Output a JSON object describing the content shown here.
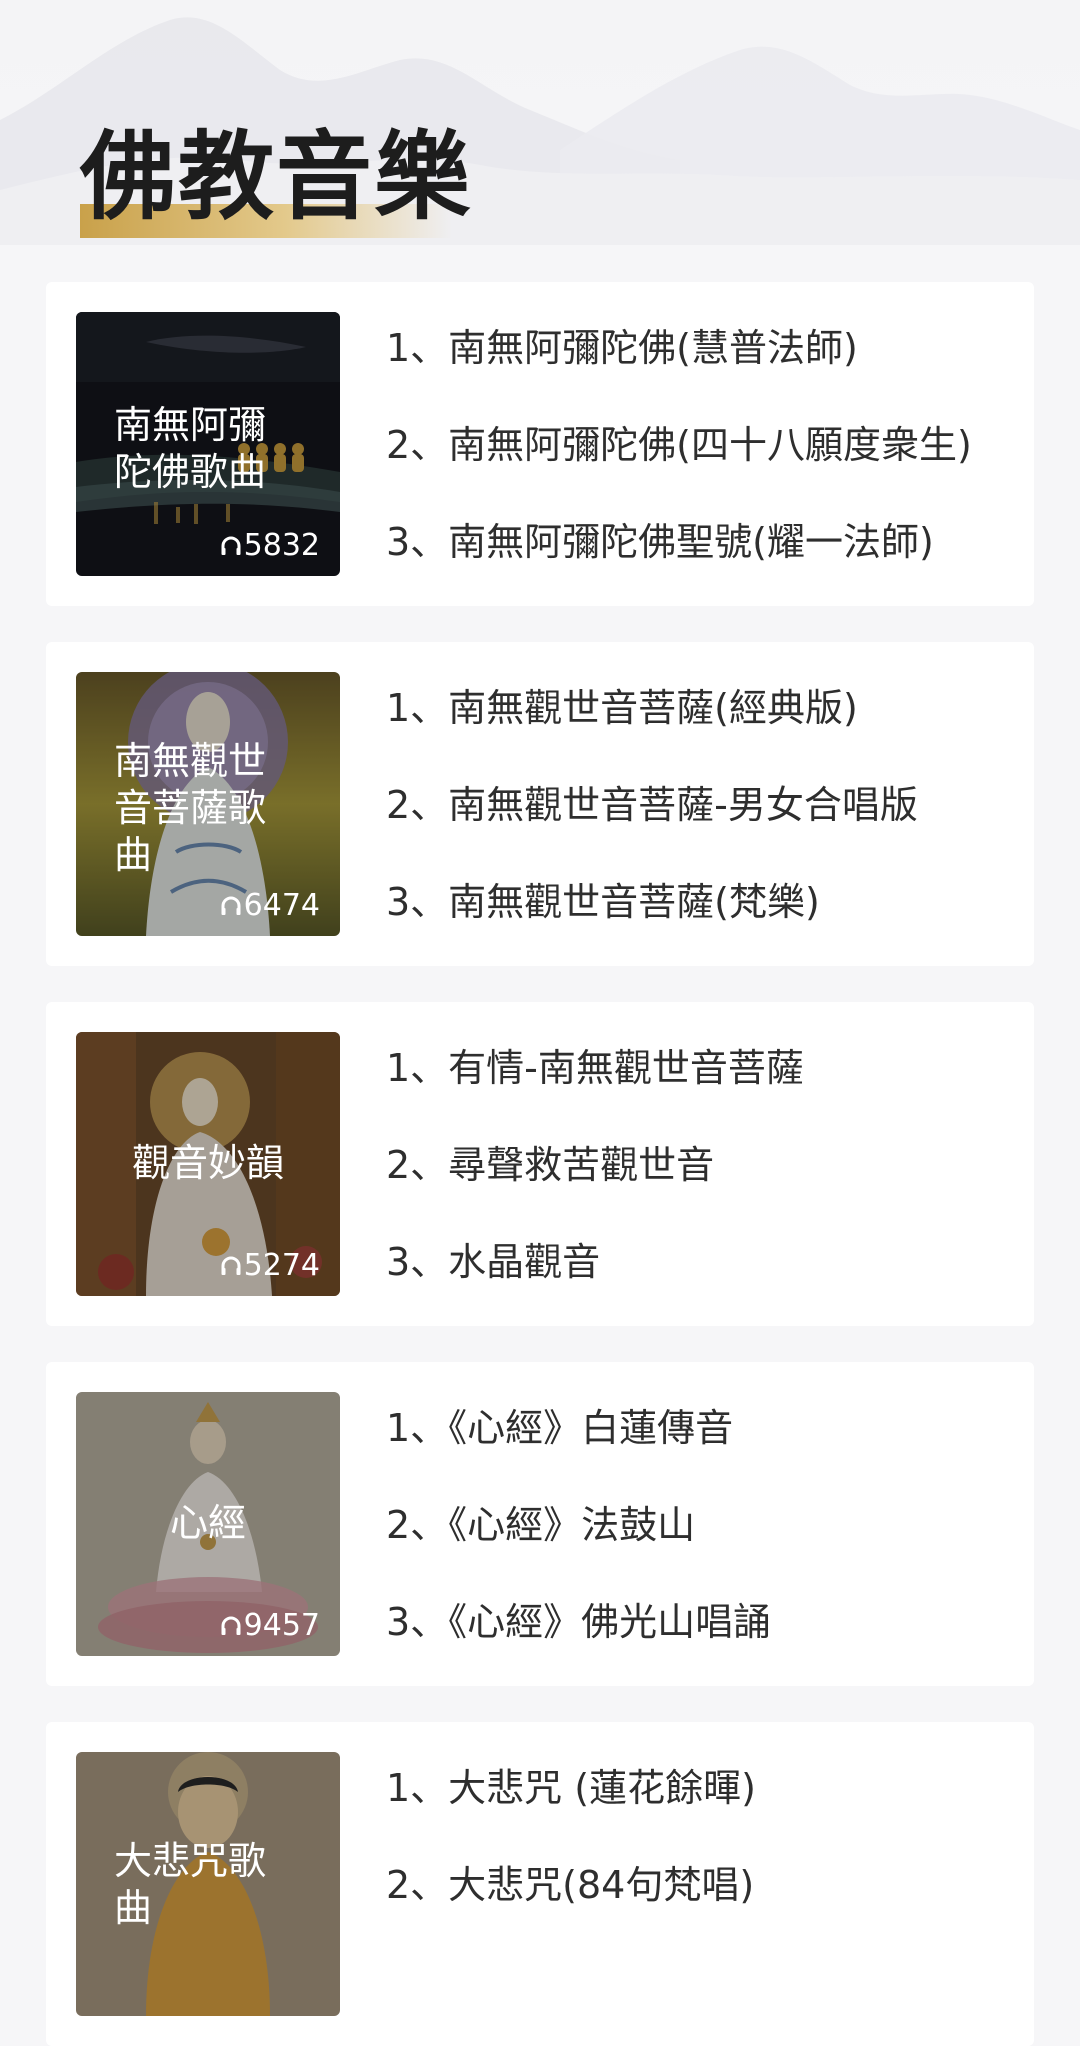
{
  "page": {
    "title": "佛教音樂"
  },
  "albums": [
    {
      "cover_title": "南無阿彌陀佛歌曲",
      "play_count": "5832",
      "tracks": [
        "1、南無阿彌陀佛(慧普法師)",
        "2、南無阿彌陀佛(四十八願度衆生)",
        "3、南無阿彌陀佛聖號(耀一法師)"
      ]
    },
    {
      "cover_title": "南無觀世音菩薩歌曲",
      "play_count": "6474",
      "tracks": [
        "1、南無觀世音菩薩(經典版)",
        "2、南無觀世音菩薩-男女合唱版",
        "3、南無觀世音菩薩(梵樂)"
      ]
    },
    {
      "cover_title": "觀音妙韻",
      "play_count": "5274",
      "tracks": [
        "1、有情-南無觀世音菩薩",
        "2、尋聲救苦觀世音",
        "3、水晶觀音"
      ]
    },
    {
      "cover_title": "心經",
      "play_count": "9457",
      "tracks": [
        "1、《心經》白蓮傳音",
        "2、《心經》法鼓山",
        "3、《心經》佛光山唱誦"
      ]
    },
    {
      "cover_title": "大悲咒歌曲",
      "tracks": [
        "1、大悲咒 (蓮花餘暉)",
        "2、大悲咒(84句梵唱)"
      ]
    }
  ],
  "icons": {
    "play_count": "headphone-icon"
  },
  "colors": {
    "title_accent": "#c9a14a",
    "background": "#f6f6f8",
    "card": "#ffffff",
    "text": "#2e2e2e"
  }
}
